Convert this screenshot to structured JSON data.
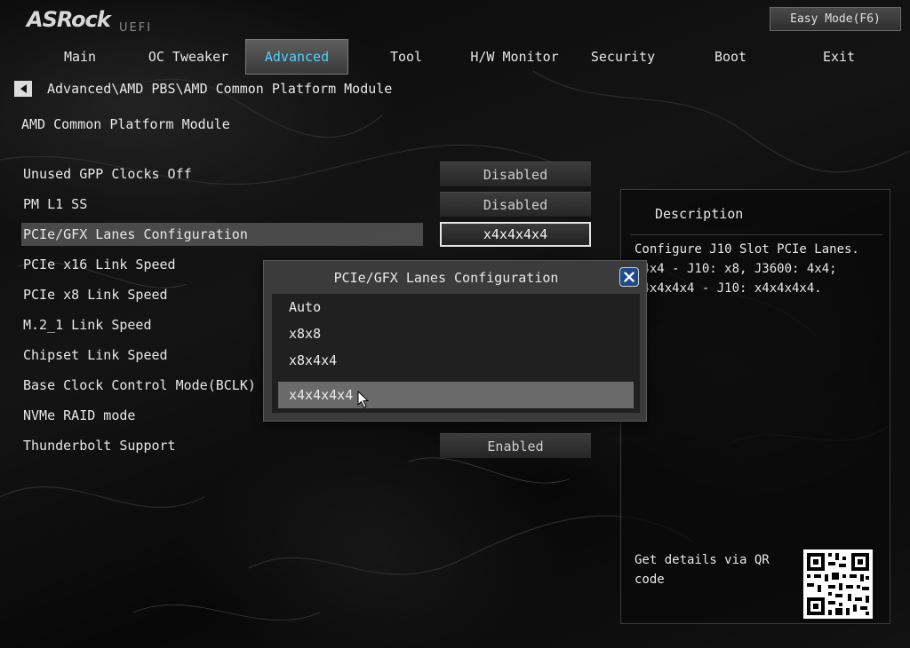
{
  "brand": {
    "logo": "ASRock",
    "subtitle": "UEFI"
  },
  "header": {
    "easy_mode_label": "Easy Mode(F6)"
  },
  "tabs": [
    {
      "label": "Main"
    },
    {
      "label": "OC Tweaker"
    },
    {
      "label": "Advanced"
    },
    {
      "label": "Tool"
    },
    {
      "label": "H/W Monitor"
    },
    {
      "label": "Security"
    },
    {
      "label": "Boot"
    },
    {
      "label": "Exit"
    }
  ],
  "active_tab": "Advanced",
  "breadcrumb": "Advanced\\AMD PBS\\AMD Common Platform Module",
  "section_title": "AMD Common Platform Module",
  "settings": [
    {
      "label": "Unused GPP Clocks Off",
      "value": "Disabled"
    },
    {
      "label": "PM L1 SS",
      "value": "Disabled"
    },
    {
      "label": "PCIe/GFX Lanes Configuration",
      "value": "x4x4x4x4"
    },
    {
      "label": "PCIe x16 Link Speed",
      "value": ""
    },
    {
      "label": "PCIe x8 Link Speed",
      "value": ""
    },
    {
      "label": "M.2_1 Link Speed",
      "value": ""
    },
    {
      "label": "Chipset Link Speed",
      "value": ""
    },
    {
      "label": "Base Clock Control Mode(BCLK)",
      "value": ""
    },
    {
      "label": "NVMe RAID mode",
      "value": ""
    },
    {
      "label": "Thunderbolt Support",
      "value": "Enabled"
    }
  ],
  "selected_setting": "PCIe/GFX Lanes Configuration",
  "description": {
    "title": "Description",
    "text": "Configure J10 Slot PCIe Lanes.\nx4x4 - J10: x8, J3600: 4x4;\nx4x4x4x4 - J10: x4x4x4x4.",
    "qr_text": "Get details via QR code"
  },
  "popup": {
    "title": "PCIe/GFX Lanes Configuration",
    "options": [
      {
        "label": "Auto"
      },
      {
        "label": "x8x8"
      },
      {
        "label": "x8x4x4"
      },
      {
        "label": "x4x4x4x4"
      }
    ],
    "selected": "x4x4x4x4"
  },
  "colors": {
    "active_tab_text": "#4fd2ff",
    "popup_close_bg": "#1e4a8a",
    "selected_row_bg": "#787878"
  }
}
